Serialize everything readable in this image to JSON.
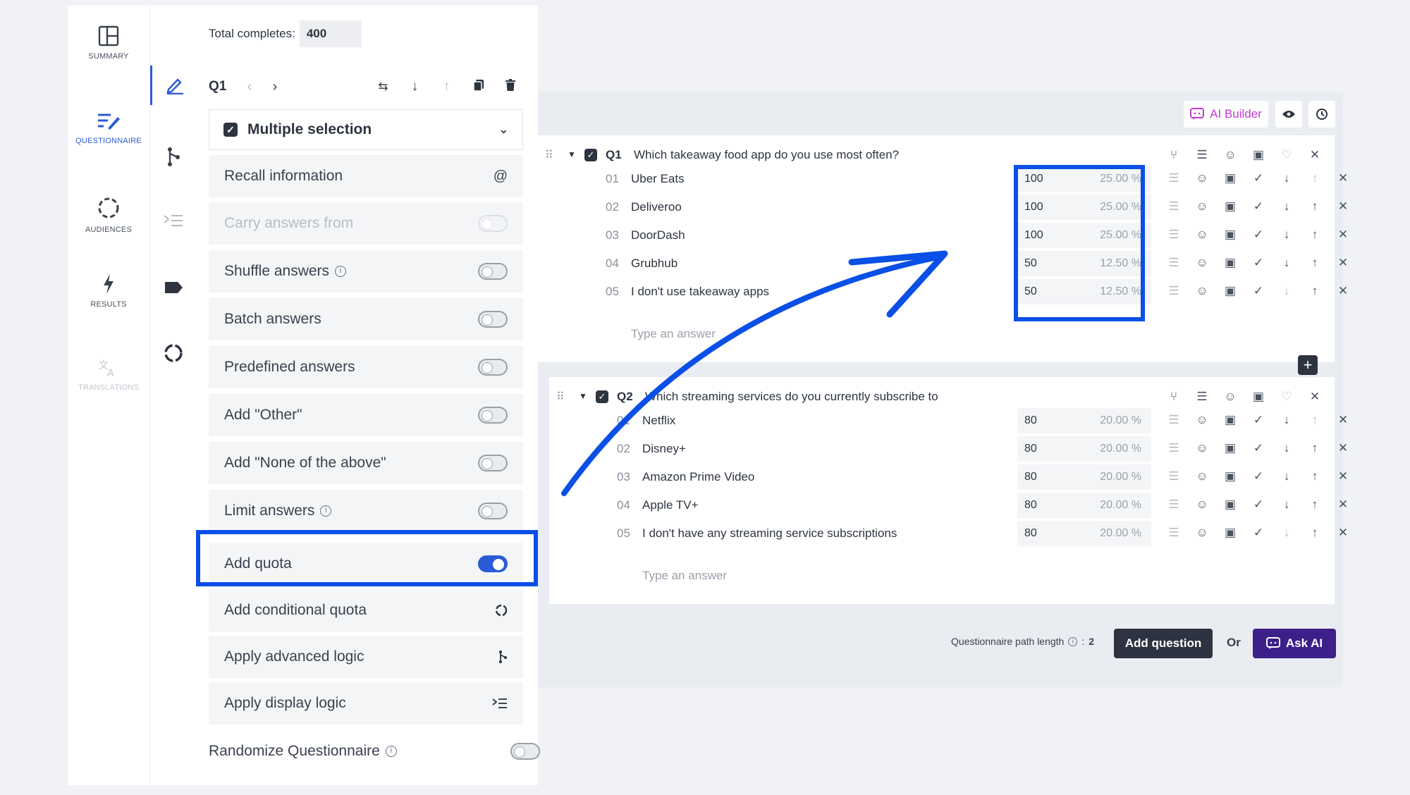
{
  "nav": {
    "summary": "SUMMARY",
    "questionnaire": "QUESTIONNAIRE",
    "audiences": "AUDIENCES",
    "results": "RESULTS",
    "translations": "TRANSLATIONS"
  },
  "header": {
    "total_label": "Total completes:",
    "total_value": "400"
  },
  "panel": {
    "question_id": "Q1",
    "question_type": "Multiple selection",
    "recall": "Recall information",
    "recall_symbol": "@",
    "carry": "Carry answers from",
    "shuffle": "Shuffle answers",
    "batch": "Batch answers",
    "predefined": "Predefined answers",
    "other": "Add \"Other\"",
    "none": "Add \"None of the above\"",
    "limit": "Limit answers",
    "quota": "Add quota",
    "cond_quota": "Add conditional quota",
    "adv_logic": "Apply advanced logic",
    "disp_logic": "Apply display logic",
    "randomize": "Randomize Questionnaire"
  },
  "toolbar": {
    "ai_builder": "AI Builder"
  },
  "q1": {
    "id": "Q1",
    "text": "Which takeaway food app do you use most often?",
    "placeholder": "Type an answer",
    "answers": [
      {
        "n": "01",
        "label": "Uber Eats",
        "count": "100",
        "pct": "25.00 %"
      },
      {
        "n": "02",
        "label": "Deliveroo",
        "count": "100",
        "pct": "25.00 %"
      },
      {
        "n": "03",
        "label": "DoorDash",
        "count": "100",
        "pct": "25.00 %"
      },
      {
        "n": "04",
        "label": "Grubhub",
        "count": "50",
        "pct": "12.50 %"
      },
      {
        "n": "05",
        "label": "I don't use takeaway apps",
        "count": "50",
        "pct": "12.50 %"
      }
    ]
  },
  "q2": {
    "id": "Q2",
    "text": "Which streaming services do you currently subscribe to",
    "placeholder": "Type an answer",
    "answers": [
      {
        "n": "01",
        "label": "Netflix",
        "count": "80",
        "pct": "20.00 %"
      },
      {
        "n": "02",
        "label": "Disney+",
        "count": "80",
        "pct": "20.00 %"
      },
      {
        "n": "03",
        "label": "Amazon Prime Video",
        "count": "80",
        "pct": "20.00 %"
      },
      {
        "n": "04",
        "label": "Apple TV+",
        "count": "80",
        "pct": "20.00 %"
      },
      {
        "n": "05",
        "label": "I don't have any streaming service subscriptions",
        "count": "80",
        "pct": "20.00 %"
      }
    ]
  },
  "footer": {
    "path_label": "Questionnaire path length",
    "path_value": "2",
    "add_question": "Add question",
    "or": "Or",
    "ask_ai": "Ask AI"
  },
  "colors": {
    "accent": "#2b5bd7",
    "highlight": "#0a4fe6",
    "dark_button": "#2d3340",
    "ai_button": "#3d1f8a",
    "ai_builder": "#c23bd4"
  }
}
